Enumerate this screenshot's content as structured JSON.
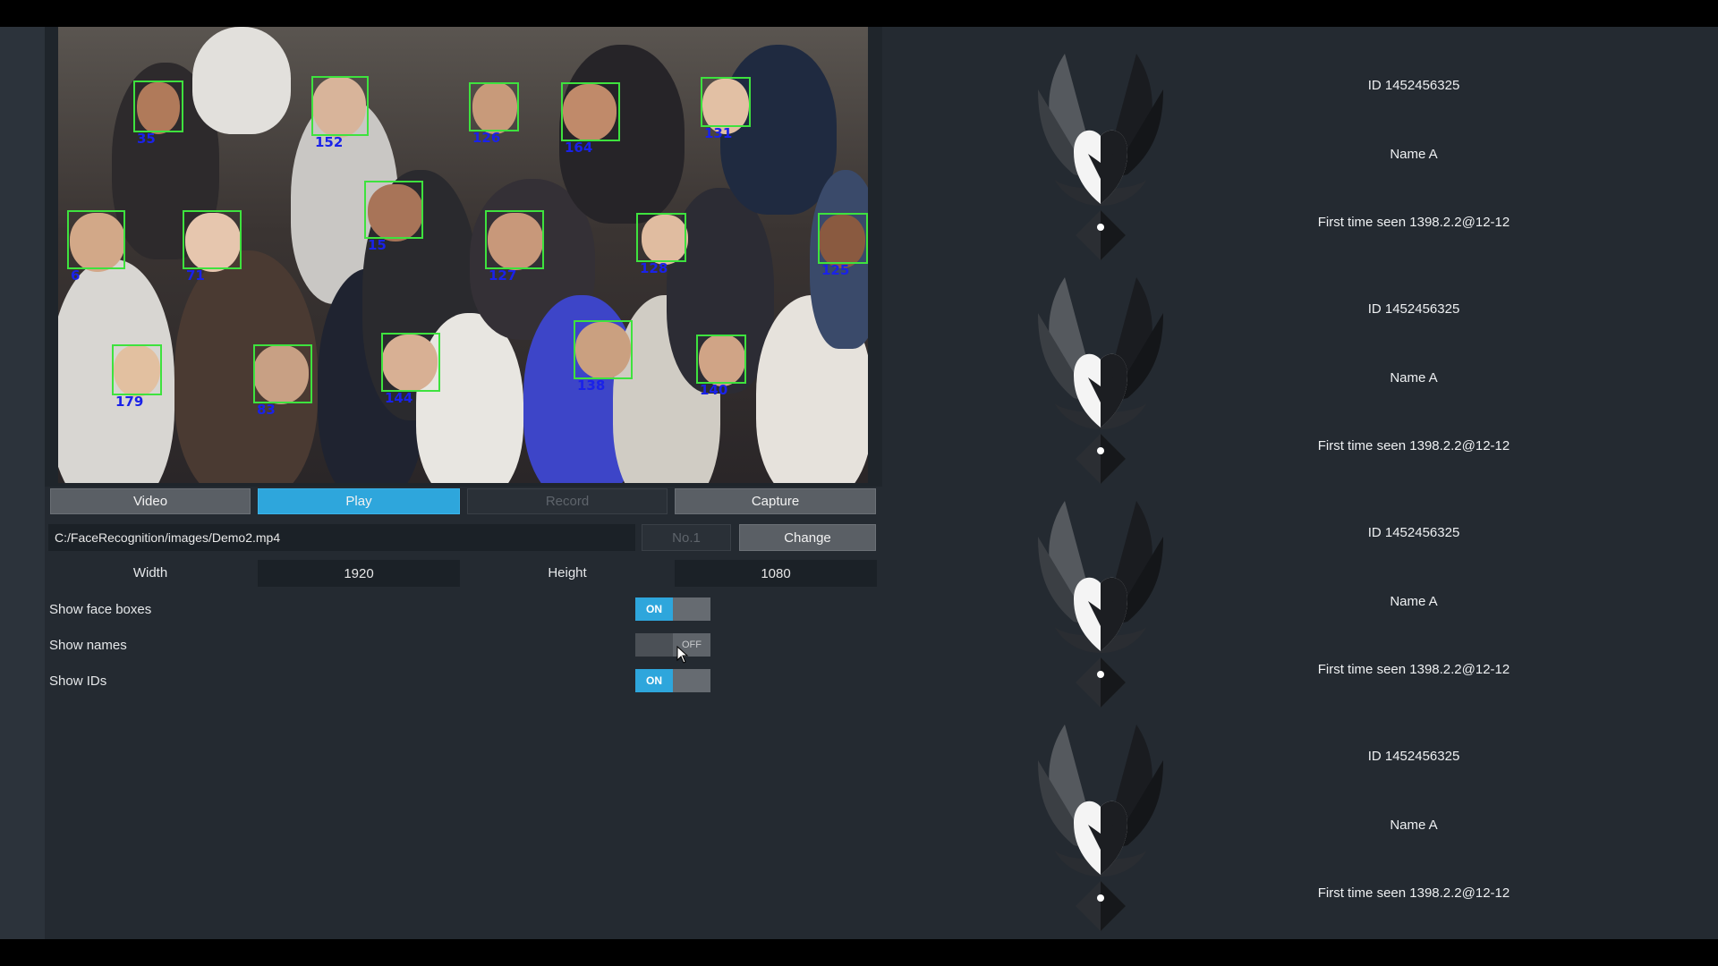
{
  "video": {
    "faces": [
      {
        "id": "35"
      },
      {
        "id": "152"
      },
      {
        "id": "126"
      },
      {
        "id": "164"
      },
      {
        "id": "131"
      },
      {
        "id": "6"
      },
      {
        "id": "71"
      },
      {
        "id": "15"
      },
      {
        "id": "127"
      },
      {
        "id": "128"
      },
      {
        "id": "125"
      },
      {
        "id": "179"
      },
      {
        "id": "83"
      },
      {
        "id": "144"
      },
      {
        "id": "138"
      },
      {
        "id": "140"
      }
    ]
  },
  "toolbar": {
    "video_label": "Video",
    "play_label": "Play",
    "record_label": "Record",
    "capture_label": "Capture"
  },
  "source": {
    "path_value": "C:/FaceRecognition/images/Demo2.mp4",
    "camera_value": "No.1",
    "change_label": "Change"
  },
  "resolution": {
    "width_label": "Width",
    "width_value": "1920",
    "height_label": "Height",
    "height_value": "1080"
  },
  "settings": [
    {
      "label": "Show face boxes",
      "state": "ON",
      "enabled": true
    },
    {
      "label": "Show names",
      "state": "OFF",
      "enabled": false
    },
    {
      "label": "Show IDs",
      "state": "ON",
      "enabled": true
    }
  ],
  "detections": [
    {
      "id_text": "ID 1452456325",
      "name_text": "Name A",
      "seen_text": "First time seen 1398.2.2@12-12"
    },
    {
      "id_text": "ID 1452456325",
      "name_text": "Name A",
      "seen_text": "First time seen 1398.2.2@12-12"
    },
    {
      "id_text": "ID 1452456325",
      "name_text": "Name A",
      "seen_text": "First time seen 1398.2.2@12-12"
    },
    {
      "id_text": "ID 1452456325",
      "name_text": "Name A",
      "seen_text": "First time seen 1398.2.2@12-12"
    }
  ],
  "colors": {
    "accent": "#2ea6dc",
    "face_box": "#3ee23e",
    "face_label": "#1a22e8",
    "background": "#242a31"
  }
}
